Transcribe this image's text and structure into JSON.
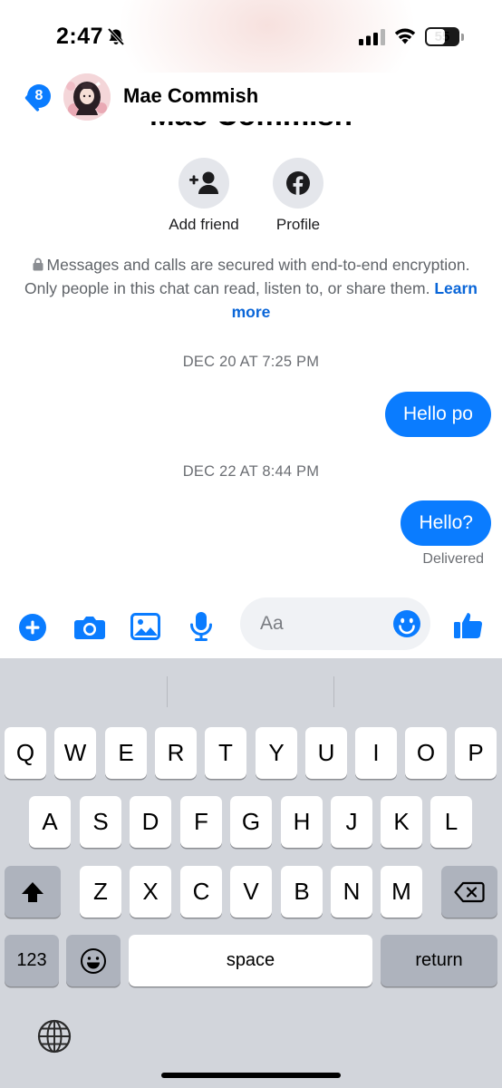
{
  "status_bar": {
    "time": "2:47",
    "battery": "55",
    "icons": [
      "bell-slash-icon",
      "signal-icon",
      "wifi-icon",
      "battery-icon"
    ]
  },
  "header": {
    "back_badge": "8",
    "name": "Mae Commish",
    "icons": [
      "chevron-left-icon",
      "avatar"
    ]
  },
  "profile": {
    "name": "Mae Commish",
    "actions": [
      {
        "label": "Add friend",
        "icon": "add-friend-icon"
      },
      {
        "label": "Profile",
        "icon": "facebook-icon"
      }
    ]
  },
  "encryption": {
    "text": "Messages and calls are secured with end-to-end encryption. Only people in this chat can read, listen to, or share them.",
    "link": "Learn more"
  },
  "messages": [
    {
      "timestamp": "DEC 20 AT 7:25 PM",
      "text": "Hello po"
    },
    {
      "timestamp": "DEC 22 AT 8:44 PM",
      "text": "Hello?",
      "status": "Delivered"
    }
  ],
  "composer": {
    "placeholder": "Aa",
    "icons": [
      "plus-icon",
      "camera-icon",
      "image-icon",
      "microphone-icon",
      "emoji-icon",
      "thumbs-up-icon"
    ]
  },
  "keyboard": {
    "row1": [
      "Q",
      "W",
      "E",
      "R",
      "T",
      "Y",
      "U",
      "I",
      "O",
      "P"
    ],
    "row2": [
      "A",
      "S",
      "D",
      "F",
      "G",
      "H",
      "J",
      "K",
      "L"
    ],
    "row3": [
      "Z",
      "X",
      "C",
      "V",
      "B",
      "N",
      "M"
    ],
    "numbers": "123",
    "space": "space",
    "return": "return",
    "icons": [
      "shift-icon",
      "backspace-icon",
      "emoji-key-icon",
      "globe-icon"
    ]
  },
  "colors": {
    "accent": "#0a7cff",
    "link": "#0a66d8",
    "keyboard_bg": "#d2d5db"
  }
}
